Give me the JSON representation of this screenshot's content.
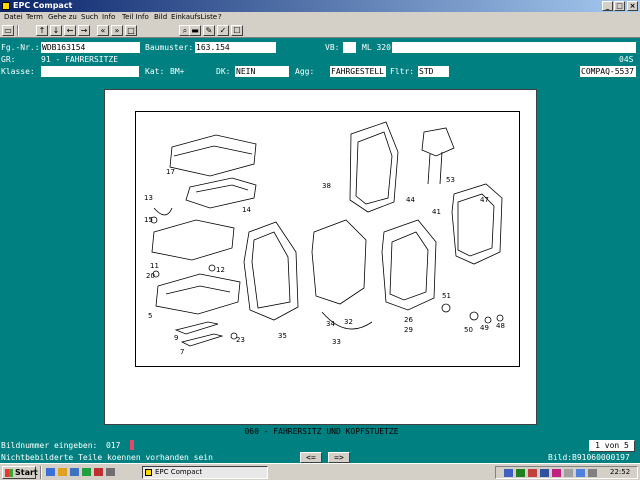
{
  "window": {
    "title": "EPC Compact"
  },
  "menu": [
    "Datei",
    "Term",
    "Gehe zu",
    "Such",
    "Info",
    "Teil Info",
    "Bild",
    "EinkaufsListe",
    "?"
  ],
  "toolbar": {
    "buttons": [
      "arrow-up",
      "arrow-down",
      "arrow-left",
      "arrow-right",
      "double-left",
      "double-right",
      "pages",
      "search",
      "car",
      "sign",
      "cart-add",
      "cart"
    ],
    "glyphs": [
      "↑",
      "↓",
      "←",
      "→",
      "«",
      "»",
      "□",
      "⌕",
      "▬",
      "✎",
      "✓",
      "☐"
    ]
  },
  "header": {
    "fgnr_label": "Fg.-Nr.:",
    "fgnr_value": "WDB163154",
    "baumuster_label": "Baumuster:",
    "baumuster_value": "163.154",
    "vb_label": "VB:",
    "vb_value": "ML 320",
    "gr_label": "GR:",
    "gr_value": "91 - FAHRERSITZE",
    "code": "04S",
    "klasse_label": "Klasse:",
    "kat_label": "Kat:",
    "kat_value": "BM+",
    "dk_label": "DK:",
    "dk_value": "NEIN",
    "agg_label": "Agg:",
    "agg_value": "FAHRGESTELL",
    "fltr_label": "Fltr:",
    "fltr_value": "STD",
    "device": "COMPAQ-5537"
  },
  "picture": {
    "caption": "060 - FAHRERSITZ UND KOPFSTUETZE",
    "part_numbers": [
      "17",
      "13",
      "14",
      "15",
      "11",
      "12",
      "20",
      "5",
      "9",
      "7",
      "23",
      "35",
      "38",
      "34",
      "33",
      "32",
      "44",
      "41",
      "53",
      "47",
      "26",
      "29",
      "51",
      "50",
      "49",
      "48"
    ]
  },
  "status": {
    "prompt_label": "Bildnummer eingeben:",
    "prompt_value": "017",
    "page_indicator": "1 von 5",
    "note": "Nichtbebilderte Teile koennen vorhanden sein",
    "prev_label": "<=",
    "next_label": "=>",
    "bild_label": "Bild:",
    "bild_value": "B91060000197"
  },
  "taskbar": {
    "start_label": "Start",
    "app_label": "EPC Compact",
    "clock": "22:52",
    "tray_icons": [
      "tray-icon-1",
      "tray-icon-2",
      "tray-icon-3",
      "tray-icon-4",
      "tray-icon-5",
      "tray-icon-6",
      "tray-icon-7",
      "tray-icon-8"
    ]
  },
  "colors": {
    "background": "#008080",
    "title_start": "#0a246a",
    "title_end": "#a6caf0",
    "chrome": "#d4d0c8"
  }
}
